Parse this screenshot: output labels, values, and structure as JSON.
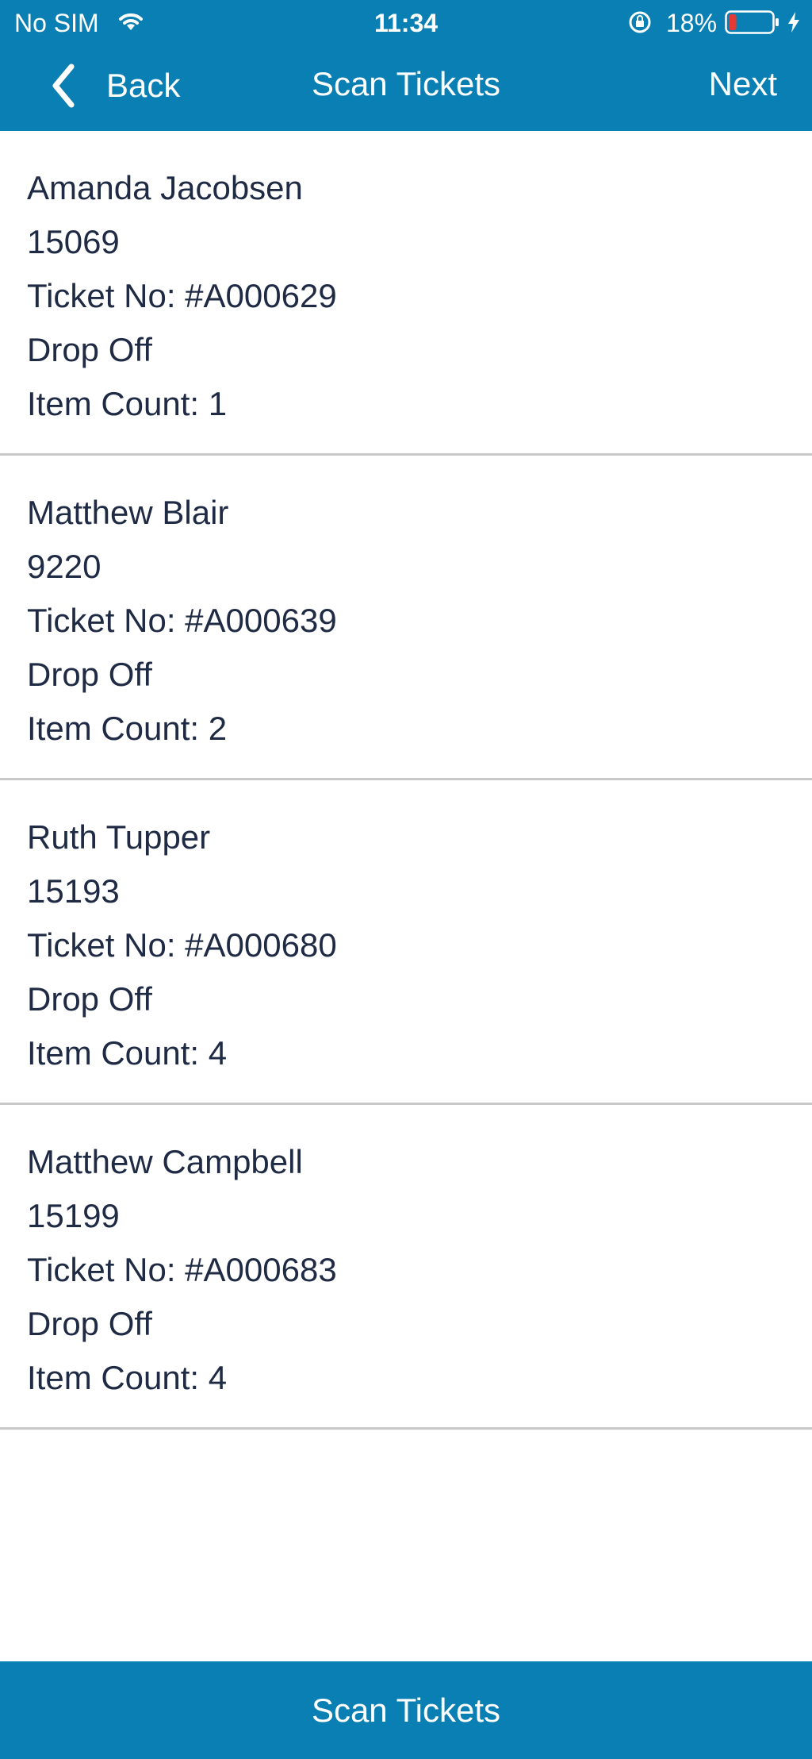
{
  "status_bar": {
    "carrier": "No SIM",
    "time": "11:34",
    "battery_percent": "18%",
    "battery_level": 0.18,
    "battery_color": "#e53935"
  },
  "nav": {
    "back_label": "Back",
    "title": "Scan Tickets",
    "next_label": "Next"
  },
  "tickets": [
    {
      "name": "Amanda Jacobsen",
      "number": "15069",
      "ticket": "Ticket No: #A000629",
      "type": "Drop Off",
      "count": "Item Count: 1"
    },
    {
      "name": "Matthew Blair",
      "number": "9220",
      "ticket": "Ticket No: #A000639",
      "type": "Drop Off",
      "count": "Item Count: 2"
    },
    {
      "name": "Ruth Tupper",
      "number": "15193",
      "ticket": "Ticket No: #A000680",
      "type": "Drop Off",
      "count": "Item Count: 4"
    },
    {
      "name": "Matthew Campbell",
      "number": "15199",
      "ticket": "Ticket No: #A000683",
      "type": "Drop Off",
      "count": "Item Count: 4"
    }
  ],
  "footer": {
    "scan_button_label": "Scan Tickets"
  },
  "colors": {
    "accent": "#0a7fb3",
    "text": "#1f2a44",
    "divider": "#c8c8c8"
  }
}
